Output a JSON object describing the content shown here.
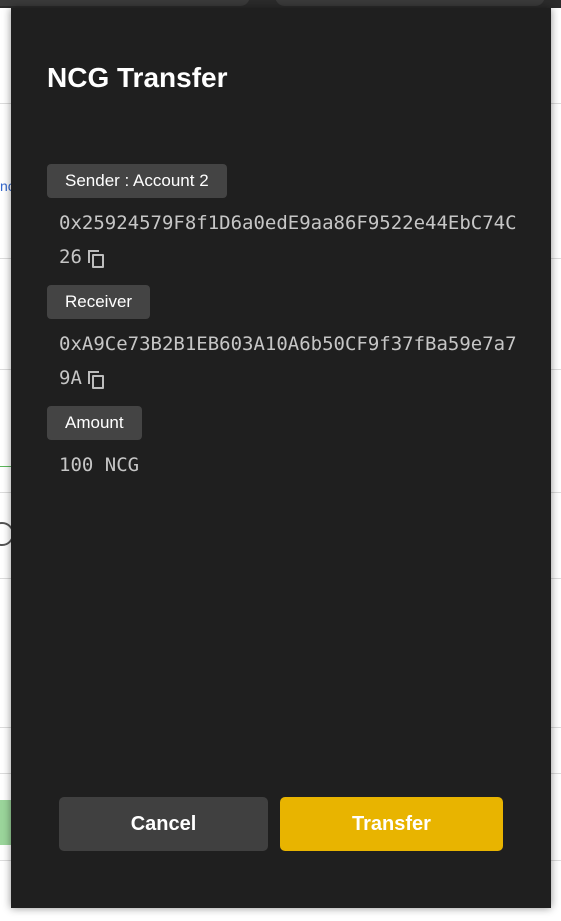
{
  "dialog": {
    "title": "NCG Transfer",
    "sender_label": "Sender : Account 2",
    "sender_address": "0x25924579F8f1D6a0edE9aa86F9522e44EbC74C26",
    "receiver_label": "Receiver",
    "receiver_address": "0xA9Ce73B2B1EB603A10A6b50CF9f37fBa59e7a79A",
    "amount_label": "Amount",
    "amount_value": "100 NCG",
    "cancel_label": "Cancel",
    "transfer_label": "Transfer"
  },
  "background": {
    "link_fragment": "nc"
  },
  "icons": {
    "copy": "copy-icon"
  },
  "colors": {
    "popup_bg": "#1f1f1f",
    "label_bg": "#444444",
    "transfer_button": "#e8b400",
    "cancel_button": "#404040"
  }
}
